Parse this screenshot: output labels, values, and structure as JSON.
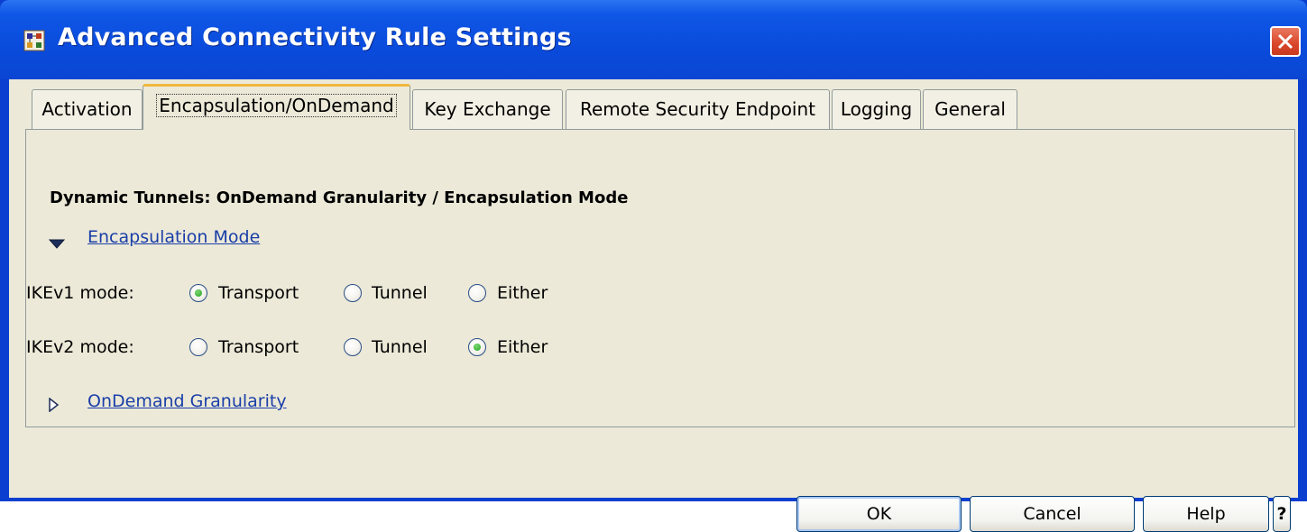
{
  "window": {
    "title": "Advanced Connectivity Rule Settings",
    "title_icon": "network-rule-icon",
    "close_icon": "close-icon"
  },
  "tabs": [
    {
      "label": "Activation",
      "active": false
    },
    {
      "label": "Encapsulation/OnDemand",
      "active": true
    },
    {
      "label": "Key Exchange",
      "active": false
    },
    {
      "label": "Remote Security Endpoint",
      "active": false
    },
    {
      "label": "Logging",
      "active": false
    },
    {
      "label": "General",
      "active": false
    }
  ],
  "panel": {
    "title": "Dynamic Tunnels: OnDemand Granularity / Encapsulation Mode",
    "encapsulation_section": {
      "label": "Encapsulation Mode",
      "expanded": true
    },
    "ikev1": {
      "label": "IKEv1 mode:",
      "options": [
        "Transport",
        "Tunnel",
        "Either"
      ],
      "selected": "Transport"
    },
    "ikev2": {
      "label": "IKEv2 mode:",
      "options": [
        "Transport",
        "Tunnel",
        "Either"
      ],
      "selected": "Either"
    },
    "ondemand_section": {
      "label": "OnDemand Granularity",
      "expanded": false
    }
  },
  "buttons": {
    "ok": "OK",
    "cancel": "Cancel",
    "help": "Help",
    "context_help": "?"
  },
  "colors": {
    "titlebar": "#0a4bdc",
    "dialog_bg": "#ece9d8",
    "link": "#1a3ea8",
    "active_tab_accent": "#f0b83c"
  }
}
